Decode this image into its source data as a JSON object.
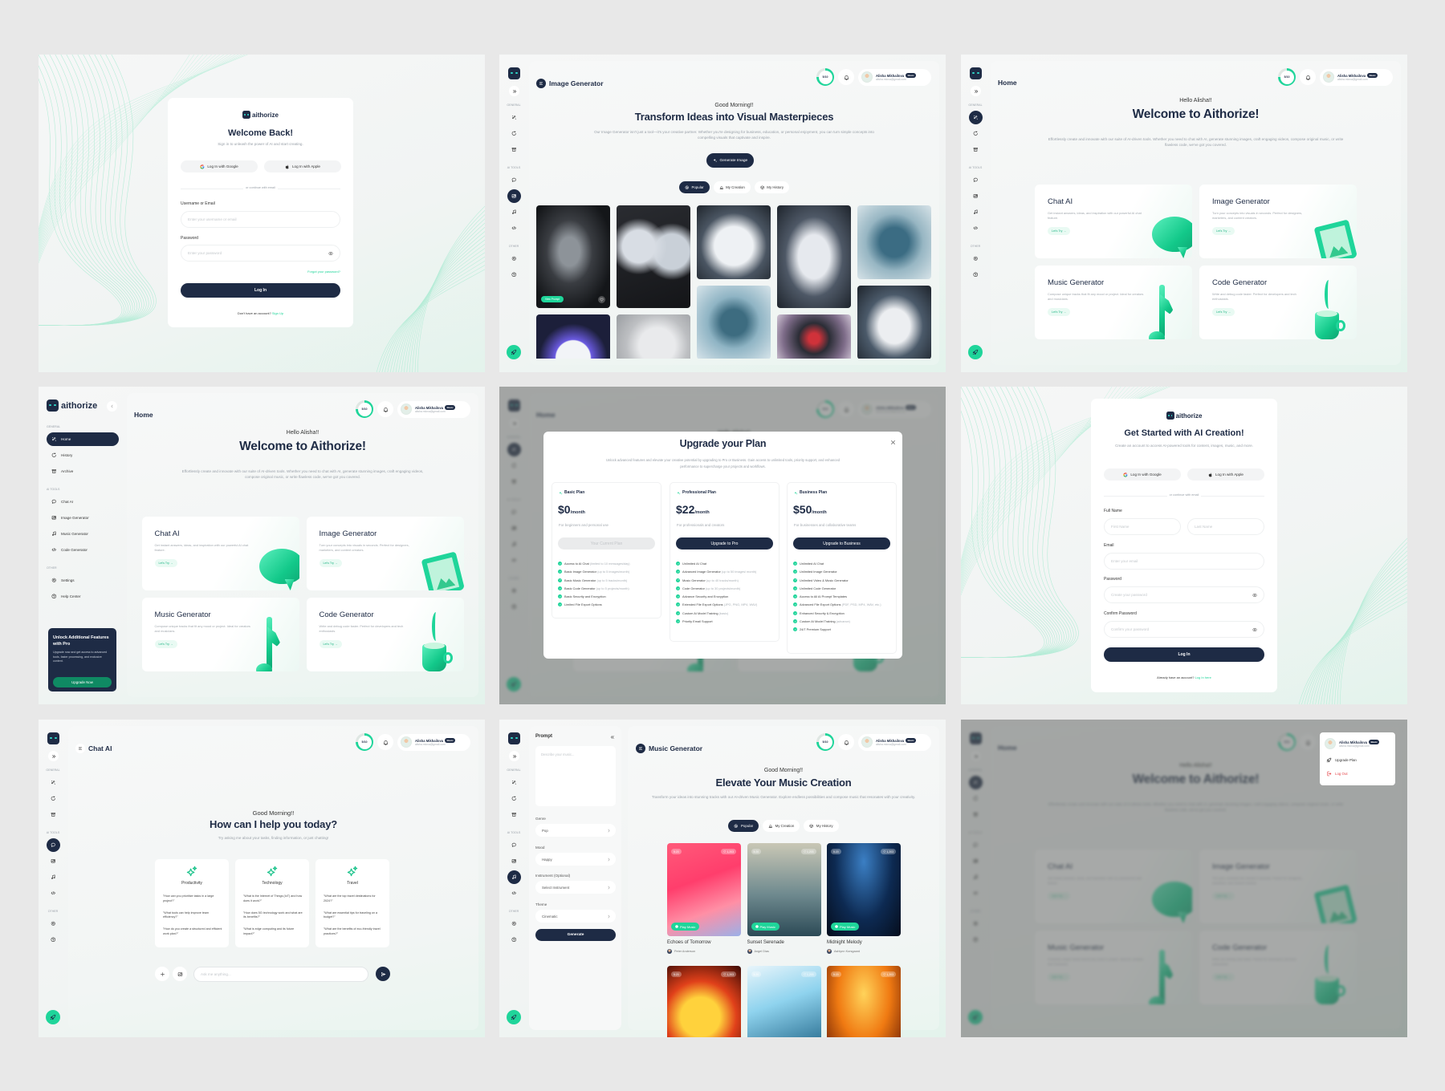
{
  "brand": {
    "name": "aithorize",
    "colors": {
      "primary": "#1e2b45",
      "accent": "#1fd59a",
      "accent_dark": "#0f8a63",
      "danger": "#e5484d"
    }
  },
  "user": {
    "name": "Alisha Mikhailova",
    "email": "alisha.mlova@gmail.com",
    "plan_badge": "Basic",
    "credits": "5/10",
    "credits_ring_fill": 0.75
  },
  "sidebar": {
    "collapse_icon": "chevron-left",
    "sections": [
      {
        "label": "GENERAL",
        "items": [
          {
            "label": "Home",
            "icon": "sparkle-network"
          },
          {
            "label": "History",
            "icon": "history"
          },
          {
            "label": "Archive",
            "icon": "archive"
          }
        ]
      },
      {
        "label": "AI TOOLS",
        "items": [
          {
            "label": "Chat AI",
            "icon": "chat"
          },
          {
            "label": "Image Generator",
            "icon": "image"
          },
          {
            "label": "Music Generator",
            "icon": "music"
          },
          {
            "label": "Code Generator",
            "icon": "code"
          }
        ]
      },
      {
        "label": "OTHER",
        "items": [
          {
            "label": "Settings",
            "icon": "settings"
          },
          {
            "label": "Help Center",
            "icon": "help"
          }
        ]
      }
    ],
    "promo": {
      "title": "Unlock Additional Features with Pro",
      "text": "Upgrade now and get access to advanced tools, faster processing, and exclusive content.",
      "button": "Upgrade Now"
    }
  },
  "login": {
    "title": "Welcome Back!",
    "subtitle": "Sign in to unleash the power of AI and start creating.",
    "google": "Log In with Google",
    "apple": "Log In with Apple",
    "divider": "or continue with email",
    "username_label": "Username or Email",
    "username_placeholder": "Enter your username or email",
    "password_label": "Password",
    "password_placeholder": "Enter your password",
    "forgot": "Forgot your password?",
    "submit": "Log In",
    "footer_text": "Don't have an account?",
    "footer_link": "Sign Up"
  },
  "signup": {
    "title": "Get Started with AI Creation!",
    "subtitle": "Create an account to access AI-powered tools for content, images, music, and more.",
    "google": "Log In with Google",
    "apple": "Log In with Apple",
    "divider": "or continue with email",
    "fullname_label": "Full Name",
    "first_placeholder": "First Name",
    "last_placeholder": "Last Name",
    "email_label": "Email",
    "email_placeholder": "Enter your email",
    "password_label": "Password",
    "password_placeholder": "Create your password",
    "confirm_label": "Confirm Password",
    "confirm_placeholder": "Confirm your password",
    "submit": "Log In",
    "footer_text": "Already have an account?",
    "footer_link": "Log In here"
  },
  "image_generator": {
    "title": "Image Generator",
    "greeting": "Good Morning!!",
    "headline": "Transform Ideas into Visual Masterpieces",
    "description": "Our Image Generator isn't just a tool—it's your creative partner. Whether you're designing for business, education, or personal enjoyment, you can turn simple concepts into compelling visuals that captivate and inspire.",
    "generate_button": "Generate Image",
    "tabs": [
      {
        "label": "Popular",
        "icon": "popular",
        "active": true
      },
      {
        "label": "My Creation",
        "icon": "creation"
      },
      {
        "label": "My History",
        "icon": "history-box"
      }
    ],
    "view_prompt": "View Prompt"
  },
  "home": {
    "title": "Home",
    "greeting": "Hello Alisha!!",
    "headline": "Welcome to Aithorize!",
    "description": "Effortlessly create and innovate with our suite of AI-driven tools. Whether you need to chat with AI, generate stunning images, craft engaging videos, compose original music, or write flawless code, we've got you covered.",
    "cards": [
      {
        "title": "Chat AI",
        "description": "Get instant answers, ideas, and inspiration with our powerful AI chat feature.",
        "cta": "Let's Try →",
        "illustration": "chat-bubble"
      },
      {
        "title": "Image Generator",
        "description": "Turn your concepts into visuals in seconds. Perfect for designers, marketers, and content creators.",
        "cta": "Let's Try →",
        "illustration": "picture-frame"
      },
      {
        "title": "Music Generator",
        "description": "Compose unique tracks that fit any mood or project. Ideal for creators and musicians.",
        "cta": "Let's Try →",
        "illustration": "music-note"
      },
      {
        "title": "Code Generator",
        "description": "Write and debug code faster. Perfect for developers and tech enthusiasts.",
        "cta": "Let's Try →",
        "illustration": "coffee-cup"
      }
    ]
  },
  "upgrade": {
    "title": "Upgrade your Plan",
    "description": "Unlock advanced features and elevate your creative potential by upgrading to Pro or Business. Gain access to unlimited tools, priority support, and enhanced performance to supercharge your projects and workflows.",
    "plans": [
      {
        "name": "Basic Plan",
        "price": "$0",
        "period": "/month",
        "subtitle": "For beginners and personal use",
        "button": "Your Current Plan",
        "current": true,
        "features": [
          {
            "text": "Access to AI Chat",
            "note": "(limited to 10 messages/day)"
          },
          {
            "text": "Basic Image Generator",
            "note": "(up to 5 images/month)"
          },
          {
            "text": "Basic Music Generator",
            "note": "(up to 5 tracks/month)"
          },
          {
            "text": "Basic Code Generator",
            "note": "(up to 5 projects/month)"
          },
          {
            "text": "Basic Security and Encryption",
            "note": ""
          },
          {
            "text": "Limited File Export Options",
            "note": ""
          }
        ]
      },
      {
        "name": "Professional Plan",
        "price": "$22",
        "period": "/month",
        "subtitle": "For professionals and creators",
        "button": "Upgrade to Pro",
        "current": false,
        "features": [
          {
            "text": "Unlimited AI Chat",
            "note": ""
          },
          {
            "text": "Advanced Image Generator",
            "note": "(up to 50 images/ month)"
          },
          {
            "text": "Music Generator",
            "note": "(up to 40 tracks/month)"
          },
          {
            "text": "Code Generator",
            "note": "(up to 30 projects/month)"
          },
          {
            "text": "Advance Security and Encryption",
            "note": ""
          },
          {
            "text": "Extended File Export Options",
            "note": "(JPG, PNG, MP4, WAV)"
          },
          {
            "text": "Custom AI Model Training",
            "note": "(basic)"
          },
          {
            "text": "Priority Email Support",
            "note": ""
          }
        ]
      },
      {
        "name": "Business Plan",
        "price": "$50",
        "period": "/month",
        "subtitle": "For businesses and collaborative teams",
        "button": "Upgrade to Business",
        "current": false,
        "features": [
          {
            "text": "Unlimited AI Chat",
            "note": ""
          },
          {
            "text": "Unlimited Image Generator",
            "note": ""
          },
          {
            "text": "Unlimited Video & Music Generator",
            "note": ""
          },
          {
            "text": "Unlimited Code Generator",
            "note": ""
          },
          {
            "text": "Access to All AI Prompt Templates",
            "note": ""
          },
          {
            "text": "Advanced File Export Options",
            "note": "(PDF, PSD, MP4, WAV, etc.)"
          },
          {
            "text": "Enhanced Security & Encryption",
            "note": ""
          },
          {
            "text": "Custom AI Model Training",
            "note": "(advance)"
          },
          {
            "text": "24/7 Premium Support",
            "note": ""
          }
        ]
      }
    ]
  },
  "chat": {
    "title": "Chat AI",
    "greeting": "Good Morning!!",
    "headline": "How can I help you today?",
    "subtitle": "Try asking me about your tasks, finding information, or just chatting!",
    "categories": [
      {
        "title": "Productivity",
        "questions": [
          "\"How can you prioritize tasks in a large project?\"",
          "\"What tools can help improve team efficiency?\"",
          "\"How do you create a structured and efficient work plan?\""
        ]
      },
      {
        "title": "Technology",
        "questions": [
          "\"What is the Internet of Things (IoT) and how does it work?\"",
          "\"How does 5G technology work and what are its benefits?\"",
          "\"What is edge computing and its future impact?\""
        ]
      },
      {
        "title": "Travel",
        "questions": [
          "\"What are the top travel destinations for 2024?\"",
          "\"What are essential tips for traveling on a budget?\"",
          "\"What are the benefits of eco-friendly travel practices?\""
        ]
      }
    ],
    "input_placeholder": "Ask me anything..."
  },
  "music": {
    "title": "Music Generator",
    "prompt": {
      "heading": "Prompt",
      "placeholder": "Describe your music...",
      "fields": [
        {
          "label": "Genre",
          "value": "Pop"
        },
        {
          "label": "Mood",
          "value": "Happy"
        },
        {
          "label": "Instrument (Optional)",
          "value": "Select Instrument"
        },
        {
          "label": "Theme",
          "value": "Cinematic"
        }
      ],
      "generate": "Generate"
    },
    "greeting": "Good Morning!!",
    "headline": "Elevate Your Music Creation",
    "description": "Transform your ideas into stunning tracks with our AI-driven Music Generator. Explore endless possibilities and compose music that resonates with your creativity.",
    "tabs": [
      {
        "label": "Popular",
        "icon": "popular",
        "active": true
      },
      {
        "label": "My Creation",
        "icon": "creation"
      },
      {
        "label": "My History",
        "icon": "history-box"
      }
    ],
    "play_label": "Play Music",
    "tracks": [
      {
        "title": "Echoes of Tomorrow",
        "author": "Peter Anderson",
        "duration": "5:20",
        "likes": "1,203"
      },
      {
        "title": "Sunset Serenade",
        "author": "Angel Dias",
        "duration": "5:20",
        "likes": "1,203"
      },
      {
        "title": "Midnight Melody",
        "author": "Ashlynn Korsgaard",
        "duration": "5:20",
        "likes": "1,203"
      },
      {
        "title": "",
        "author": "",
        "duration": "5:20",
        "likes": "1,203"
      },
      {
        "title": "",
        "author": "",
        "duration": "5:20",
        "likes": "1,203"
      },
      {
        "title": "",
        "author": "",
        "duration": "5:20",
        "likes": "1,203"
      }
    ]
  },
  "user_menu": {
    "upgrade": "Upgrade Plan",
    "logout": "Log Out"
  }
}
